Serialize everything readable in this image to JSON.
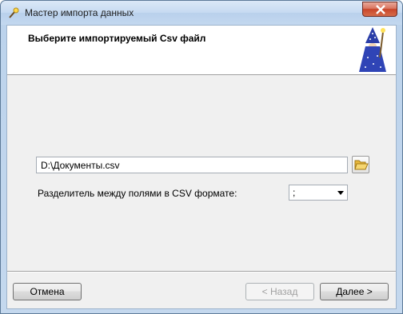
{
  "window": {
    "title": "Мастер импорта данных"
  },
  "header": {
    "title": "Выберите импортируемый Csv файл"
  },
  "form": {
    "file_path": "D:\\Документы.csv",
    "separator_label": "Разделитель между полями в CSV формате:",
    "separator_value": ";"
  },
  "buttons": {
    "cancel": "Отмена",
    "back": "< Назад",
    "next": "Далее >"
  },
  "icons": {
    "app": "wand-icon",
    "wizard": "wizard-icon",
    "browse": "folder-open-icon",
    "close": "close-icon"
  }
}
